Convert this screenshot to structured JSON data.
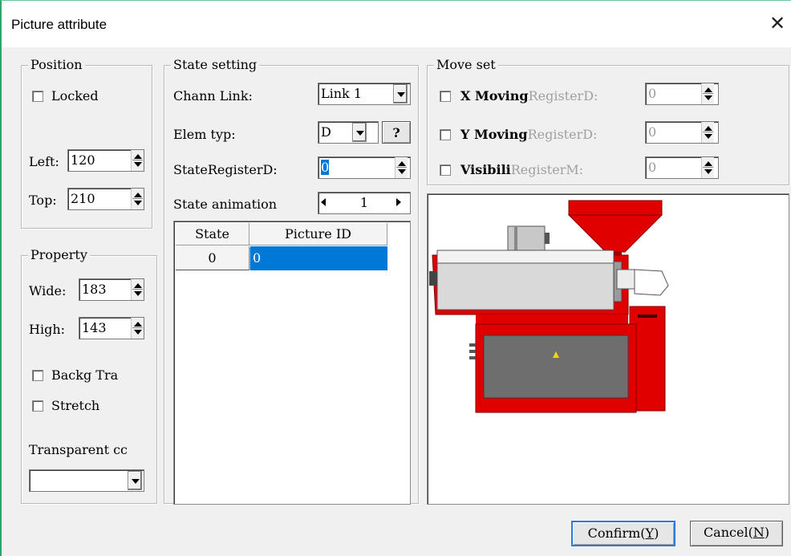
{
  "window": {
    "title": "Picture attribute"
  },
  "position": {
    "label": "Position",
    "locked_label": "Locked",
    "left_label": "Left:",
    "left_value": "120",
    "top_label": "Top:",
    "top_value": "210"
  },
  "property": {
    "label": "Property",
    "wide_label": "Wide:",
    "wide_value": "183",
    "high_label": "High:",
    "high_value": "143",
    "backg_label": "Backg Tra",
    "stretch_label": "Stretch",
    "transparent_label": "Transparent cc",
    "transparent_value": ""
  },
  "state_setting": {
    "label": "State setting",
    "chann_link_label": "Chann Link:",
    "chann_link_value": "Link 1",
    "elem_typ_label": "Elem typ:",
    "elem_typ_value": "D",
    "help_label": "?",
    "state_register_label": "StateRegisterD:",
    "state_register_value": "0",
    "state_animation_label": "State animation",
    "state_animation_value": "1",
    "columns": [
      "State",
      "Picture ID"
    ],
    "rows": [
      {
        "state": "0",
        "picture_id": "0"
      }
    ]
  },
  "move_set": {
    "label": "Move set",
    "x_label": "X Moving",
    "x_register": "RegisterD:",
    "x_value": "0",
    "y_label": "Y Moving",
    "y_register": "RegisterD:",
    "y_value": "0",
    "v_label": "Visibili",
    "v_register": "RegisterM:",
    "v_value": "0"
  },
  "buttons": {
    "confirm_prefix": "Confirm(",
    "confirm_key": "Y",
    "confirm_suffix": ")",
    "cancel_prefix": "Cancel(",
    "cancel_key": "N",
    "cancel_suffix": ")"
  },
  "colors": {
    "selection": "#0078d7",
    "machine_red": "#e00000",
    "machine_grey": "#6e6e6e",
    "accent_border": "#2aa66a"
  },
  "icons": [
    "close-icon",
    "spin-up-down-icon",
    "dropdown-arrow-icon",
    "arrow-left-icon",
    "arrow-right-icon",
    "extruder-machine-picture"
  ]
}
